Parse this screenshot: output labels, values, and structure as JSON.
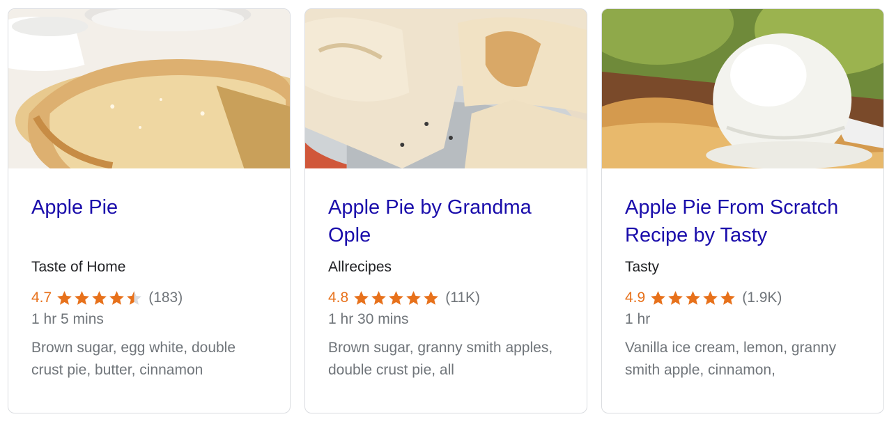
{
  "cards": [
    {
      "title": "Apple Pie",
      "source": "Taste of Home",
      "rating": "4.7",
      "rating_value": 4.7,
      "review_count": "(183)",
      "time": "1 hr 5 mins",
      "ingredients": "Brown sugar, egg white, double crust pie, butter, cinnamon"
    },
    {
      "title": "Apple Pie by Grandma Ople",
      "source": "Allrecipes",
      "rating": "4.8",
      "rating_value": 4.8,
      "review_count": "(11K)",
      "time": "1 hr 30 mins",
      "ingredients": "Brown sugar, granny smith apples, double crust pie, all"
    },
    {
      "title": "Apple Pie From Scratch Recipe by Tasty",
      "source": "Tasty",
      "rating": "4.9",
      "rating_value": 4.9,
      "review_count": "(1.9K)",
      "time": "1 hr",
      "ingredients": "Vanilla ice cream, lemon, granny smith apple, cinnamon,"
    }
  ],
  "colors": {
    "title_link": "#1a0dab",
    "rating": "#e7711b",
    "star_empty": "#dadce0",
    "meta_text": "#70757a",
    "source_text": "#202124",
    "card_border": "#dadce0"
  },
  "icons": {
    "star": "star-icon"
  }
}
